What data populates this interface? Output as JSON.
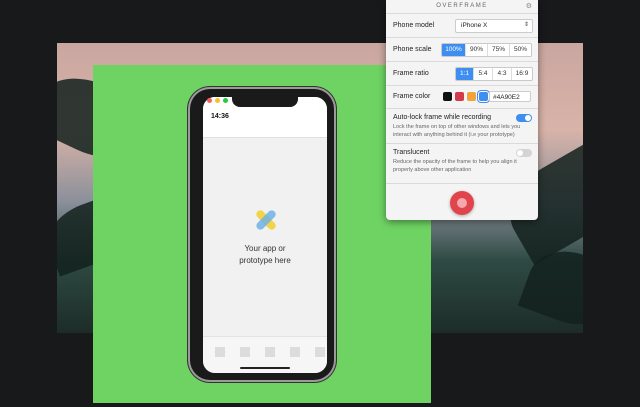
{
  "panel": {
    "title": "OVERFRAME",
    "phone_model_label": "Phone model",
    "phone_model_value": "iPhone X",
    "phone_scale_label": "Phone scale",
    "scale_options": [
      "100%",
      "90%",
      "75%",
      "50%"
    ],
    "scale_selected": "100%",
    "frame_ratio_label": "Frame ratio",
    "ratio_options": [
      "1:1",
      "5:4",
      "4:3",
      "16:9"
    ],
    "ratio_selected": "1:1",
    "frame_color_label": "Frame color",
    "color_swatches": [
      "#111111",
      "#d33a4a",
      "#f2a43a",
      "#3d8ef0",
      "#6fd363"
    ],
    "frame_color_hex": "#4A90E2",
    "autolock_label": "Auto-lock frame while recording",
    "autolock_desc": "Lock the frame on top of other windows and lets you interact with anything behind it (i.e your prototype)",
    "autolock_on": true,
    "translucent_label": "Translucent",
    "translucent_desc": "Reduce the opacity of the frame to help you align it properly above other application",
    "translucent_on": false
  },
  "phone": {
    "time": "14:36",
    "placeholder_line1": "Your app or",
    "placeholder_line2": "prototype here"
  },
  "colors": {
    "frame_green": "#6fd363",
    "accent_blue": "#3d8ef0",
    "record_red": "#e0444c"
  }
}
